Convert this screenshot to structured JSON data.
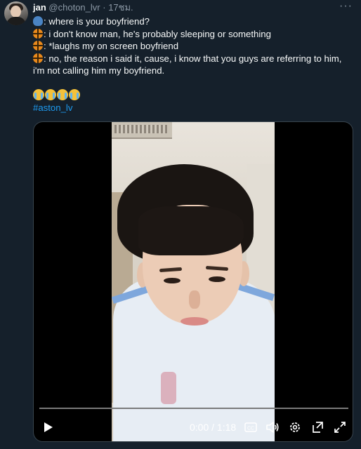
{
  "author": {
    "name": "jan",
    "handle": "@choton_lvr",
    "separator": "·",
    "time": "17ชม."
  },
  "more_label": "···",
  "lines": [
    {
      "icon": "person-icon",
      "text": ": where is your boyfriend?"
    },
    {
      "icon": "basketball-icon",
      "text": ": i don't know man, he's probably sleeping or something"
    },
    {
      "icon": "basketball-icon",
      "text": ": *laughs my on screen boyfriend"
    },
    {
      "icon": "basketball-icon",
      "text": ": no, the reason i said it, cause, i know that you guys are referring to him, i'm not calling him my boyfriend."
    }
  ],
  "emoji_row": [
    "crying-face-icon",
    "crying-face-icon",
    "crying-face-icon",
    "crying-face-icon"
  ],
  "hashtag": "#aston_lv",
  "video": {
    "timecode": "0:00 / 1:18",
    "progress": 0,
    "cc_label": "CC"
  },
  "colors": {
    "background": "#15202b",
    "accent": "#1d9bf0",
    "text": "#f7f9f9",
    "muted": "#8b98a5"
  }
}
